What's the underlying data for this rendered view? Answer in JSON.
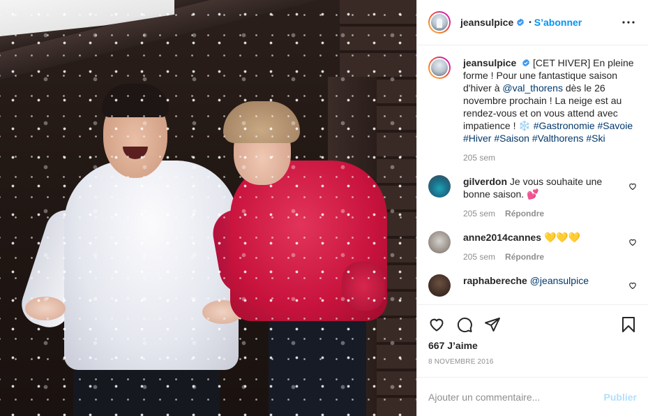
{
  "post": {
    "author": {
      "username": "jeansulpice",
      "verified": true,
      "follow_label": "S’abonner",
      "separator": "•"
    },
    "more_icon": "more-horizontal-icon",
    "caption": {
      "username": "jeansulpice",
      "text_1": "[CET HIVER] En pleine forme ! Pour une fantastique saison d'hiver à ",
      "mention": "@val_thorens",
      "text_2": " dès le 26 novembre prochain ! La neige est au rendez-vous et on vous attend avec impatience ! ❄️ ",
      "hashtags": "#Gastronomie #Savoie #Hiver #Saison #Valthorens #Ski",
      "time": "205 sem"
    },
    "comments": [
      {
        "username": "gilverdon",
        "text": "Je vous souhaite une bonne saison. 💕",
        "time": "205 sem",
        "reply_label": "Répondre"
      },
      {
        "username": "anne2014cannes",
        "text": "💛💛💛",
        "time": "205 sem",
        "reply_label": "Répondre"
      },
      {
        "username": "raphabereche",
        "text": "@jeansulpice"
      }
    ],
    "likes": "667 J’aime",
    "date": "8 NOVEMBRE 2016",
    "add_comment": {
      "placeholder": "Ajouter un commentaire...",
      "publish_label": "Publier"
    },
    "colors": {
      "link_blue": "#0095f6",
      "mention_blue": "#00376b",
      "publish_disabled": "#b2dffc",
      "muted_gray": "#8e8e8e"
    },
    "icons": [
      "heart-icon",
      "comment-icon",
      "share-icon",
      "bookmark-icon",
      "verified-badge-icon"
    ]
  }
}
